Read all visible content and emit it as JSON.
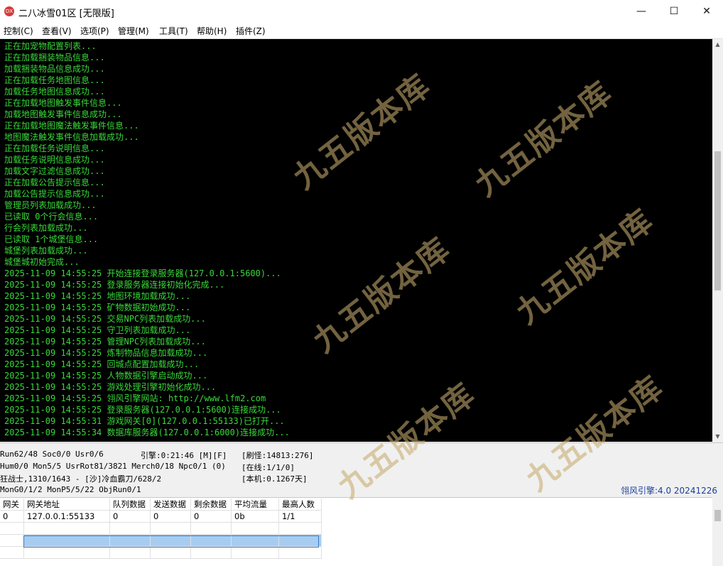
{
  "window": {
    "title": "二八冰雪01区 [无限版]",
    "icon": "DX",
    "minimize": "—",
    "maximize": "☐",
    "close": "✕"
  },
  "menu": [
    "控制(C)",
    "查看(V)",
    "选项(P)",
    "管理(M)",
    "工具(T)",
    "帮助(H)",
    "插件(Z)"
  ],
  "log": [
    "正在加宠物配置列表...",
    "正在加载捆装物品信息...",
    "加载捆装物品信息成功...",
    "正在加载任务地图信息...",
    "加载任务地图信息成功...",
    "正在加载地图触发事件信息...",
    "加载地图触发事件信息成功...",
    "正在加载地图魔法触发事件信息...",
    "地图魔法触发事件信息加载成功...",
    "正在加载任务说明信息...",
    "加载任务说明信息成功...",
    "加载文字过滤信息成功...",
    "正在加载公告提示信息...",
    "加载公告提示信息成功...",
    "管理员列表加载成功...",
    "已读取 0个行会信息...",
    "行会列表加载成功...",
    "已读取 1个城堡信息...",
    "城堡列表加载成功...",
    "城堡城初始完成...",
    "2025-11-09 14:55:25 开始连接登录服务器(127.0.0.1:5600)...",
    "2025-11-09 14:55:25 登录服务器连接初始化完成...",
    "2025-11-09 14:55:25 地图环境加载成功...",
    "2025-11-09 14:55:25 矿物数据初始成功...",
    "2025-11-09 14:55:25 交易NPC列表加载成功...",
    "2025-11-09 14:55:25 守卫列表加载成功...",
    "2025-11-09 14:55:25 管理NPC列表加载成功...",
    "2025-11-09 14:55:25 炼制物品信息加载成功...",
    "2025-11-09 14:55:25 回城点配置加载成功...",
    "2025-11-09 14:55:25 人物数据引擎启动成功...",
    "2025-11-09 14:55:25 游戏处理引擎初始化成功...",
    "2025-11-09 14:55:25 翎风引擎网站: http://www.lfm2.com",
    "2025-11-09 14:55:25 登录服务器(127.0.0.1:5600)连接成功...",
    "2025-11-09 14:55:31 游戏网关[0](127.0.0.1:55133)已打开...",
    "2025-11-09 14:55:34 数据库服务器(127.0.0.1:6000)连接成功..."
  ],
  "status": {
    "run": "Run62/48 Soc0/0 Usr0/6",
    "engine": "引擎:0:21:46 [M][F]",
    "refresh": "[刷怪:14813:276]",
    "hum": "Hum0/0 Mon5/5 UsrRot81/3821 Merch0/18 Npc0/1 (0)",
    "online": "[在线:1/1/0]",
    "char": "狂战士,1310/1643 - [沙]冷血霸刀/628/2",
    "local": "[本机:0.1267天]",
    "mon": "MonG0/1/2 MonP5/5/22 ObjRun0/1",
    "version": "翎风引擎:4.0 20241226"
  },
  "gateway_table": {
    "headers": [
      "网关",
      "网关地址",
      "队列数据",
      "发送数据",
      "剩余数据",
      "平均流量",
      "最高人数"
    ],
    "rows": [
      [
        "0",
        "127.0.0.1:55133",
        "0",
        "0",
        "0",
        "0b",
        "1/1"
      ],
      [
        "",
        "",
        "",
        "",
        "",
        "",
        ""
      ],
      [
        "",
        "",
        "",
        "",
        "",
        "",
        ""
      ],
      [
        "",
        "",
        "",
        "",
        "",
        "",
        ""
      ]
    ]
  },
  "watermark": "九五版本库",
  "watermark_url": "www.95bbk.com",
  "colors": {
    "log_text": "#39d83a",
    "console_bg": "#000000",
    "selection": "#a6cdf0",
    "watermark": "#c6aa6c"
  }
}
